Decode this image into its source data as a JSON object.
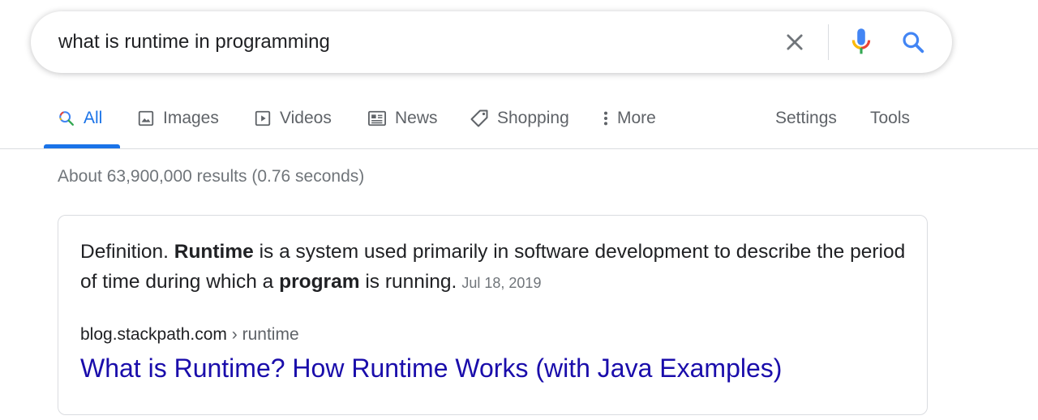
{
  "search": {
    "query": "what is runtime in programming"
  },
  "tabs": [
    {
      "label": "All",
      "icon": "search-icon",
      "active": true
    },
    {
      "label": "Images",
      "icon": "image-icon"
    },
    {
      "label": "Videos",
      "icon": "play-icon"
    },
    {
      "label": "News",
      "icon": "newspaper-icon"
    },
    {
      "label": "Shopping",
      "icon": "tag-icon"
    },
    {
      "label": "More",
      "icon": "more-vert-icon"
    }
  ],
  "tools": {
    "settings_label": "Settings",
    "tools_label": "Tools"
  },
  "stats": "About 63,900,000 results (0.76 seconds)",
  "snippet": {
    "part1": "Definition. ",
    "bold1": "Runtime",
    "part2": " is a system used primarily in software development to describe the period of time during which a ",
    "bold2": "program",
    "part3": " is running.",
    "date": "Jul 18, 2019",
    "site": "blog.stackpath.com",
    "breadcrumb": " › runtime",
    "title": "What is Runtime? How Runtime Works (with Java Examples)"
  },
  "colors": {
    "accent": "#1a73e8",
    "link": "#1a0dab",
    "muted": "#70757a"
  }
}
